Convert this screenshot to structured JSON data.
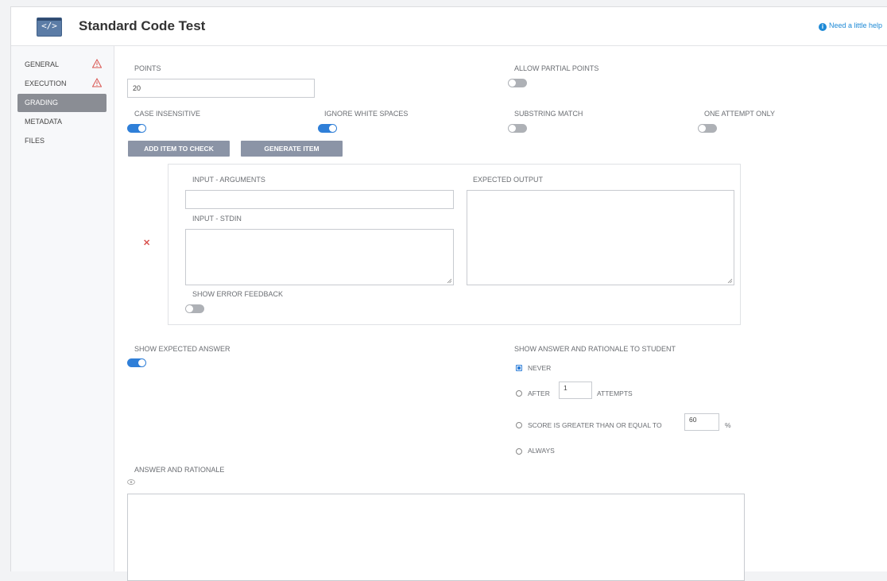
{
  "header": {
    "title": "Standard Code Test",
    "icon": "code-icon",
    "icon_text": "</>",
    "help_label": "Need a little help"
  },
  "sidebar": {
    "items": [
      {
        "label": "GENERAL",
        "warning": true
      },
      {
        "label": "EXECUTION",
        "warning": true
      },
      {
        "label": "GRADING",
        "active": true
      },
      {
        "label": "METADATA"
      },
      {
        "label": "FILES"
      }
    ]
  },
  "grading": {
    "points_label": "POINTS",
    "points_value": "20",
    "allow_partial_label": "ALLOW PARTIAL POINTS",
    "allow_partial": false,
    "case_insensitive_label": "CASE INSENSITIVE",
    "case_insensitive": true,
    "ignore_whitespace_label": "IGNORE WHITE SPACES",
    "ignore_whitespace": true,
    "substring_label": "SUBSTRING MATCH",
    "substring": false,
    "one_attempt_label": "ONE ATTEMPT ONLY",
    "one_attempt": false,
    "add_item_label": "ADD ITEM TO CHECK",
    "generate_item_label": "GENERATE ITEM",
    "item": {
      "input_args_label": "INPUT - ARGUMENTS",
      "input_args_value": "",
      "input_stdin_label": "INPUT - STDIN",
      "expected_output_label": "EXPECTED OUTPUT",
      "show_error_label": "SHOW ERROR FEEDBACK",
      "show_error": false
    },
    "show_expected_label": "SHOW EXPECTED ANSWER",
    "show_expected": true,
    "show_answer_label": "SHOW ANSWER AND RATIONALE TO STUDENT",
    "options": {
      "never": "NEVER",
      "after": "AFTER",
      "after_value": "1",
      "attempts": "ATTEMPTS",
      "score": "SCORE IS GREATER THAN OR EQUAL TO",
      "score_value": "60",
      "percent": "%",
      "always": "ALWAYS",
      "selected": "never"
    },
    "answer_rationale_label": "ANSWER AND RATIONALE"
  },
  "colors": {
    "accent": "#2f7fd8",
    "button": "#8b94a6",
    "sidebar_active": "#8a8d94",
    "warning": "#d9534f"
  }
}
